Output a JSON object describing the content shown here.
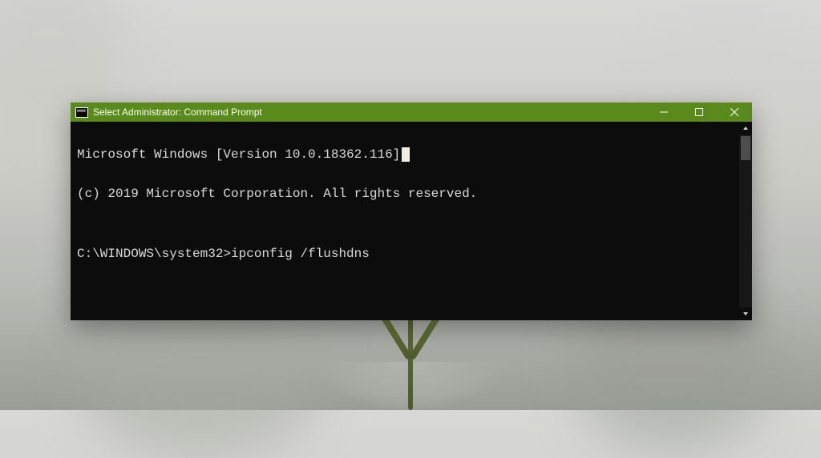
{
  "window": {
    "title": "Select Administrator: Command Prompt"
  },
  "terminal": {
    "lines": [
      "Microsoft Windows [Version 10.0.18362.116]",
      "(c) 2019 Microsoft Corporation. All rights reserved.",
      "",
      "C:\\WINDOWS\\system32>ipconfig /flushdns"
    ],
    "prompt": "C:\\WINDOWS\\system32>",
    "command": "ipconfig /flushdns"
  }
}
